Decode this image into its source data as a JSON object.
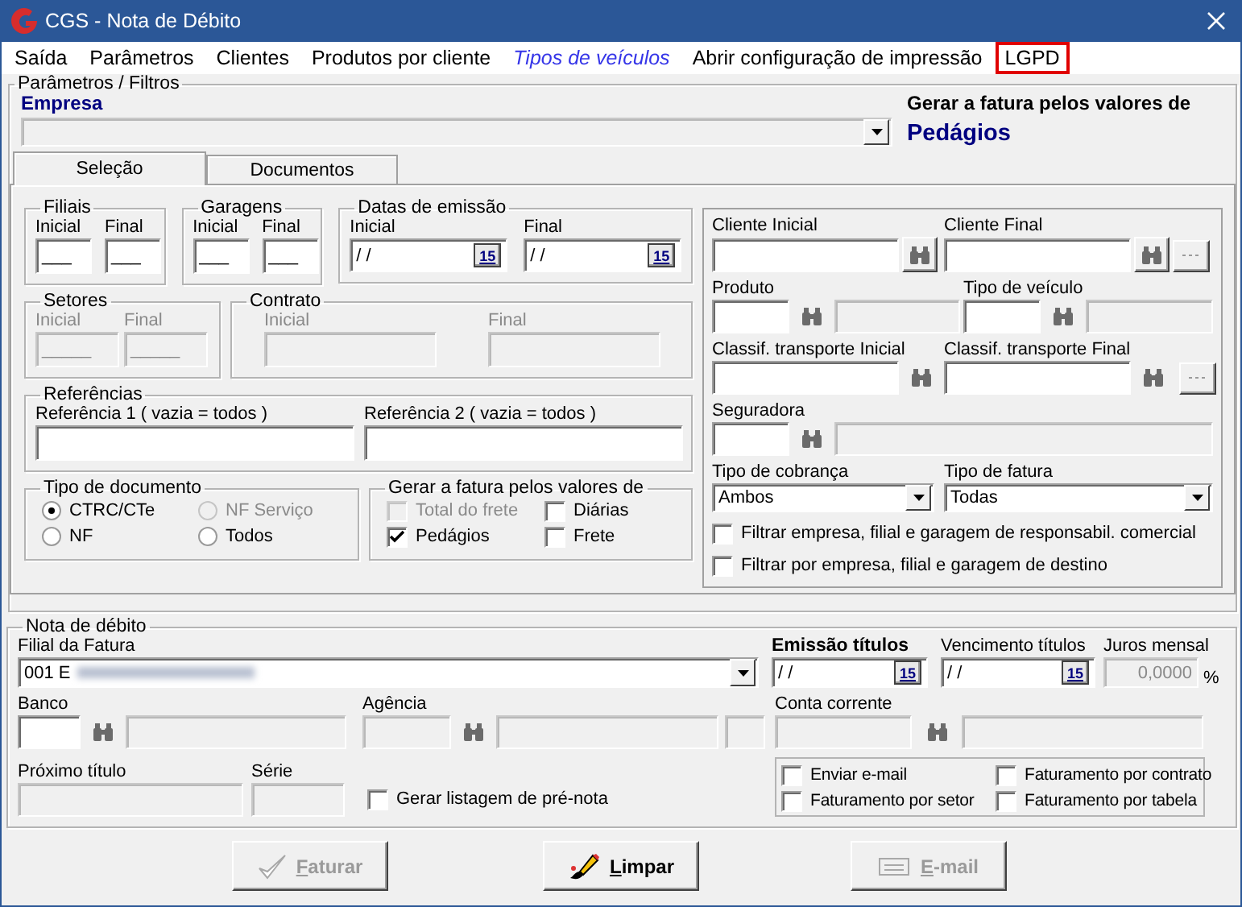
{
  "window": {
    "title": "CGS - Nota de Débito"
  },
  "menu": [
    {
      "label": "Saída",
      "kind": "item",
      "highlighted": false
    },
    {
      "label": "Parâmetros",
      "kind": "item",
      "highlighted": false
    },
    {
      "label": "Clientes",
      "kind": "item",
      "highlighted": false
    },
    {
      "label": "Produtos por cliente",
      "kind": "item",
      "highlighted": false
    },
    {
      "label": "Tipos de veículos",
      "kind": "link",
      "highlighted": false
    },
    {
      "label": "Abrir configuração de impressão",
      "kind": "item",
      "highlighted": false
    },
    {
      "label": "LGPD",
      "kind": "item",
      "highlighted": true
    }
  ],
  "filters": {
    "title": "Parâmetros / Filtros",
    "empresa": {
      "label": "Empresa",
      "disabled": true
    },
    "gerar": {
      "label": "Gerar a fatura pelos valores de",
      "value": "Pedágios"
    }
  },
  "tabs": [
    {
      "label": "Seleção",
      "selected": true
    },
    {
      "label": "Documentos",
      "selected": false
    }
  ],
  "selecao": {
    "filiais": {
      "title": "Filiais",
      "fields": [
        {
          "label": "Inicial",
          "value": "___",
          "disabled": false
        },
        {
          "label": "Final",
          "value": "___",
          "disabled": false
        }
      ]
    },
    "garagens": {
      "title": "Garagens",
      "fields": [
        {
          "label": "Inicial",
          "value": "___",
          "disabled": false
        },
        {
          "label": "Final",
          "value": "___",
          "disabled": false
        }
      ]
    },
    "datas": {
      "title": "Datas de emissão",
      "fields": [
        {
          "label": "Inicial",
          "value": "/ /",
          "calendar": "15",
          "disabled": false
        },
        {
          "label": "Final",
          "value": "/ /",
          "calendar": "15",
          "disabled": false
        }
      ]
    },
    "setores": {
      "title": "Setores",
      "fields": [
        {
          "label": "Inicial",
          "value": "_____",
          "disabled": true
        },
        {
          "label": "Final",
          "value": "_____",
          "disabled": true
        }
      ]
    },
    "contrato": {
      "title": "Contrato",
      "fields": [
        {
          "label": "Inicial",
          "disabled": true
        },
        {
          "label": "Final",
          "disabled": true
        }
      ]
    },
    "referencias": {
      "title": "Referências",
      "fields": [
        {
          "label": "Referência 1 ( vazia = todos )",
          "disabled": false
        },
        {
          "label": "Referência 2 ( vazia = todos )",
          "disabled": false
        }
      ]
    },
    "tipo_documento": {
      "title": "Tipo de documento",
      "options": [
        {
          "label": "CTRC/CTe",
          "selected": true,
          "disabled": false
        },
        {
          "label": "NF Serviço",
          "selected": false,
          "disabled": true
        },
        {
          "label": "NF",
          "selected": false,
          "disabled": false
        },
        {
          "label": "Todos",
          "selected": false,
          "disabled": false
        }
      ]
    },
    "gerar_valores": {
      "title": "Gerar a fatura pelos valores de",
      "options": [
        {
          "label": "Total do frete",
          "checked": false,
          "disabled": true
        },
        {
          "label": "Diárias",
          "checked": false,
          "disabled": false
        },
        {
          "label": "Pedágios",
          "checked": true,
          "disabled": false
        },
        {
          "label": "Frete",
          "checked": false,
          "disabled": false
        }
      ]
    },
    "cliente_inicial": {
      "label": "Cliente Inicial",
      "disabled": false
    },
    "cliente_final": {
      "label": "Cliente Final",
      "disabled": false
    },
    "produto": {
      "label": "Produto",
      "disabled": false
    },
    "tipo_veiculo": {
      "label": "Tipo de veículo",
      "disabled": false
    },
    "classif_inicial": {
      "label": "Classif. transporte Inicial",
      "disabled": false
    },
    "classif_final": {
      "label": "Classif. transporte Final",
      "disabled": false
    },
    "seguradora": {
      "label": "Seguradora",
      "disabled": false
    },
    "tipo_cobranca": {
      "label": "Tipo de cobrança",
      "value": "Ambos"
    },
    "tipo_fatura": {
      "label": "Tipo de fatura",
      "value": "Todas"
    },
    "filtros": [
      {
        "label": "Filtrar empresa, filial e garagem de responsabil. comercial",
        "checked": false
      },
      {
        "label": "Filtrar por empresa, filial e garagem de destino",
        "checked": false
      }
    ]
  },
  "nota": {
    "title": "Nota de débito",
    "filial": {
      "label": "Filial da Fatura",
      "value": "001 E",
      "blurred": true
    },
    "emissao": {
      "label": "Emissão títulos",
      "value": "/ /",
      "calendar": "15"
    },
    "vencimento": {
      "label": "Vencimento títulos",
      "value": "/ /",
      "calendar": "15"
    },
    "juros": {
      "label": "Juros mensal",
      "value": "0,0000",
      "unit": "%",
      "disabled": true
    },
    "banco": {
      "label": "Banco",
      "disabled": false
    },
    "agencia": {
      "label": "Agência",
      "disabled": true
    },
    "conta": {
      "label": "Conta corrente",
      "disabled": true
    },
    "proximo": {
      "label": "Próximo título",
      "disabled": true
    },
    "serie": {
      "label": "Série",
      "disabled": true
    },
    "pre_nota": {
      "label": "Gerar listagem de pré-nota",
      "checked": false
    },
    "opcoes": [
      {
        "label": "Enviar e-mail",
        "checked": false
      },
      {
        "label": "Faturamento por contrato",
        "checked": false
      },
      {
        "label": "Faturamento por setor",
        "checked": false
      },
      {
        "label": "Faturamento por tabela",
        "checked": false
      }
    ]
  },
  "buttons": [
    {
      "label": "Faturar",
      "kind": "faturar",
      "disabled": true,
      "first_letter_underlined": true
    },
    {
      "label": "Limpar",
      "kind": "limpar",
      "disabled": false,
      "first_letter_underlined": true
    },
    {
      "label": "E-mail",
      "kind": "email",
      "disabled": true,
      "first_letter_underlined": true
    }
  ]
}
